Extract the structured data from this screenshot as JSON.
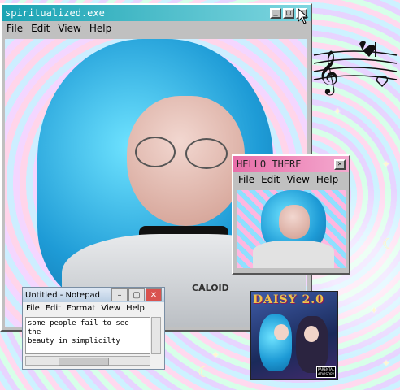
{
  "main_window": {
    "title": "spiritualized.exe",
    "menu": [
      "File",
      "Edit",
      "View",
      "Help"
    ]
  },
  "hello_window": {
    "title": "HELLO THERE",
    "menu": [
      "File",
      "Edit",
      "View",
      "Help"
    ]
  },
  "notepad": {
    "title": "Untitled - Notepad",
    "menu": [
      "File",
      "Edit",
      "Format",
      "View",
      "Help"
    ],
    "lines": [
      "some people fail to see",
      "the",
      "beauty in simplicilty"
    ]
  },
  "jacket_logo_text": "CALOID",
  "album": {
    "title": "DAISY 2.0",
    "advisory": "PARENTAL ADVISORY"
  },
  "colors": {
    "titlebar_teal": "#1aa3b3",
    "titlebar_pink": "#e86ea8",
    "window_gray": "#c0c0c0",
    "hair_blue": "#2bb5e8"
  },
  "icons": [
    "music-note-icon",
    "heart-icon",
    "star-icon",
    "moon-icon"
  ]
}
